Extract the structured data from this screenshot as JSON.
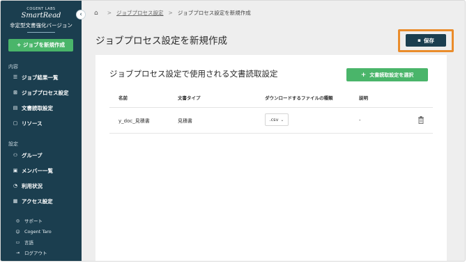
{
  "sidebar": {
    "brand_small": "COGENT LABS",
    "brand_main": "SmartRead",
    "brand_sub": "非定型文書強化バージョン",
    "collapse_icon": "chevron-left-icon",
    "new_job_label": "+ ジョブを新規作成",
    "section_content": "内容",
    "content_items": [
      {
        "label": "ジョブ結果一覧",
        "icon": "list-icon"
      },
      {
        "label": "ジョブプロセス設定",
        "icon": "flow-icon"
      },
      {
        "label": "文書読取設定",
        "icon": "document-icon"
      },
      {
        "label": "リソース",
        "icon": "resource-icon"
      }
    ],
    "section_settings": "設定",
    "settings_items": [
      {
        "label": "グループ",
        "icon": "group-icon"
      },
      {
        "label": "メンバー一覧",
        "icon": "member-card-icon"
      },
      {
        "label": "利用状況",
        "icon": "usage-icon"
      },
      {
        "label": "アクセス設定",
        "icon": "access-icon"
      }
    ],
    "footer_items": [
      {
        "label": "サポート",
        "icon": "support-icon"
      },
      {
        "label": "Cogent Taro",
        "icon": "user-icon"
      },
      {
        "label": "言語",
        "icon": "language-icon"
      },
      {
        "label": "ログアウト",
        "icon": "logout-icon"
      }
    ]
  },
  "breadcrumb": {
    "home_icon": "home-icon",
    "link": "ジョブプロセス設定",
    "current": "ジョブプロセス設定を新規作成"
  },
  "page": {
    "title": "ジョブプロセス設定を新規作成",
    "save_label": "保存",
    "highlight_color": "#ea8c2b"
  },
  "card": {
    "title": "ジョブプロセス設定で使用される文書読取設定",
    "select_label": "文書読取設定を選択",
    "columns": [
      "名前",
      "文書タイプ",
      "ダウンロードするファイルの種類",
      "説明"
    ],
    "rows": [
      {
        "name": "y_doc_見積書",
        "doc_type": "見積書",
        "file_type": ".csv",
        "description": "-"
      }
    ]
  },
  "colors": {
    "sidebar": "#1b3e4f",
    "accent_green": "#4ab56a",
    "primary_dark": "#1b3e4f"
  }
}
